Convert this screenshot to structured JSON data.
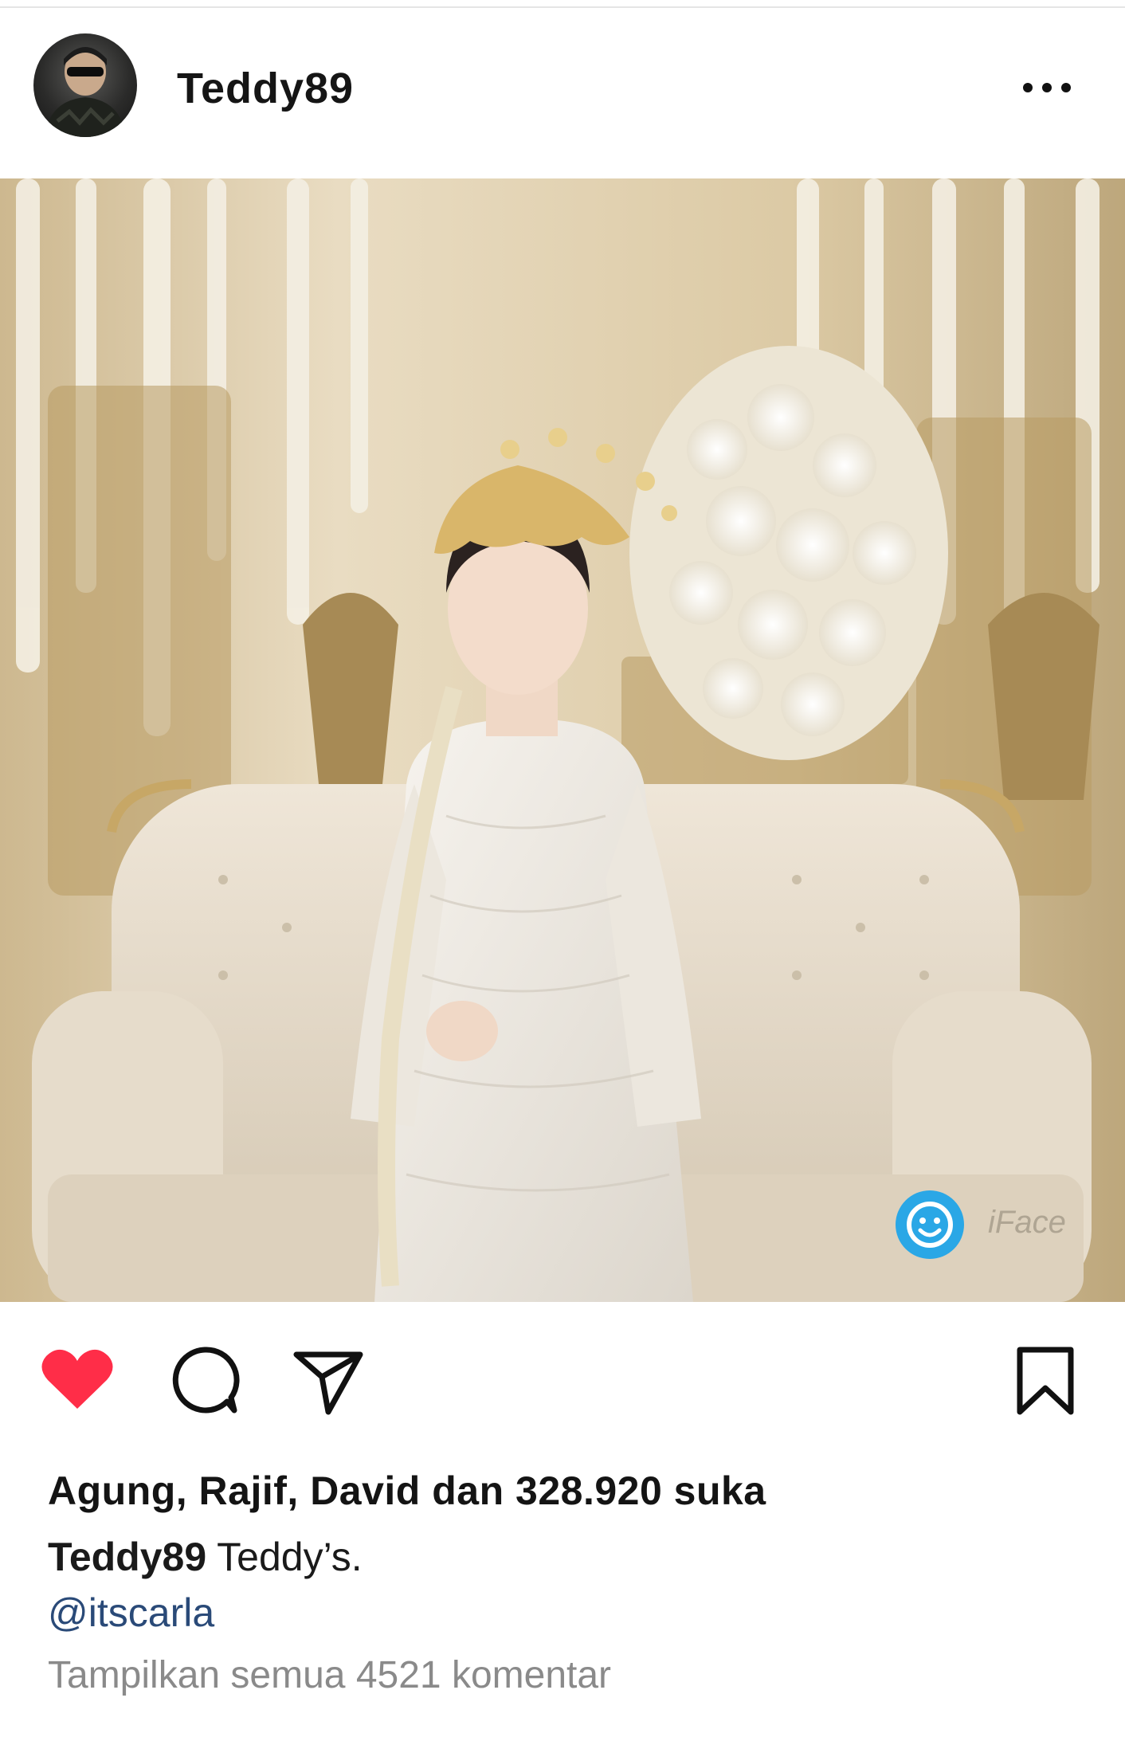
{
  "post": {
    "username": "Teddy89",
    "more_icon": "more-horizontal-icon"
  },
  "actions": {
    "like_icon": "heart-filled-icon",
    "comment_icon": "comment-icon",
    "share_icon": "send-icon",
    "save_icon": "bookmark-icon",
    "like_color": "#ff2d48"
  },
  "likes": {
    "text": "Agung, Rajif, David dan 328.920 suka"
  },
  "caption": {
    "username": "Teddy89",
    "text": " Teddy’s."
  },
  "mention": {
    "text": "@itscarla"
  },
  "comments": {
    "link_text": "Tampilkan semua 4521 komentar"
  },
  "photo": {
    "overlay_icon": "smiley-face-icon",
    "watermark_text": "iFace"
  },
  "colors": {
    "link_blue": "#2a4a78",
    "secondary_gray": "#8a8a8a",
    "badge_blue": "#2aa7e6"
  }
}
